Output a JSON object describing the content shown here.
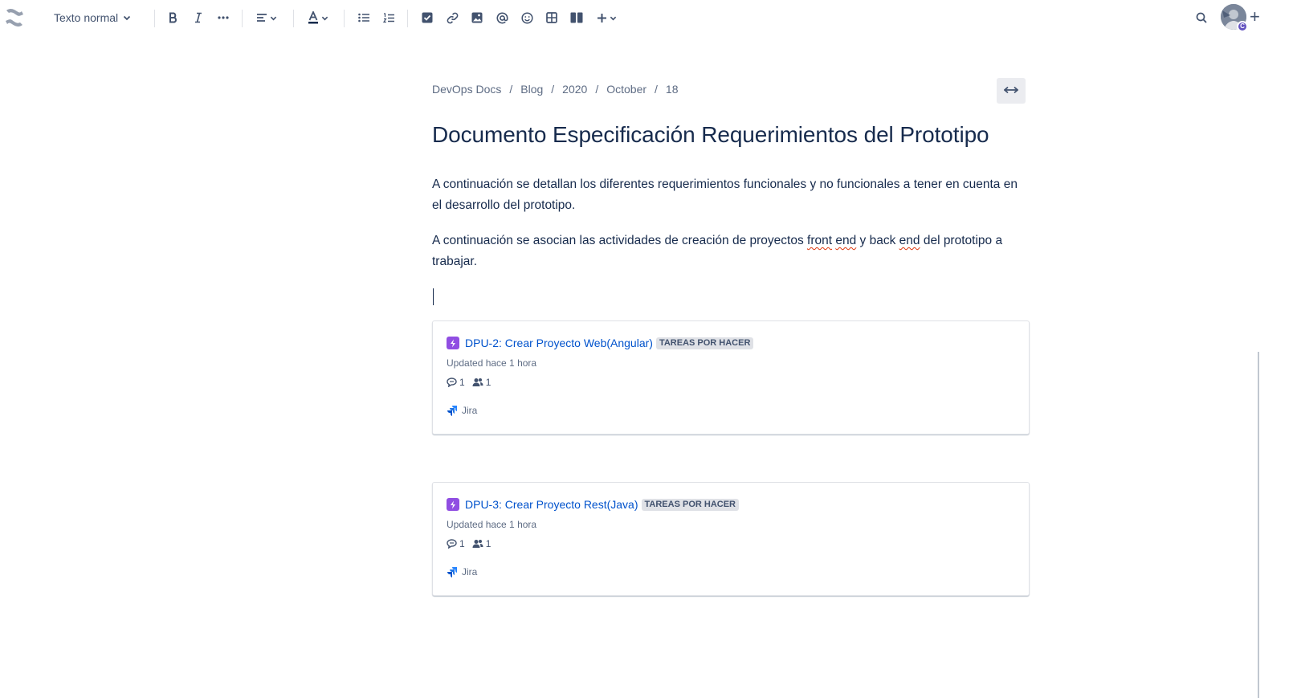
{
  "toolbar": {
    "text_style": "Texto normal",
    "tools": [
      {
        "name": "bold-icon"
      },
      {
        "name": "italic-icon"
      },
      {
        "name": "more-formatting-icon"
      },
      {
        "name": "alignment-icon"
      },
      {
        "name": "text-color-icon"
      },
      {
        "name": "bullet-list-icon"
      },
      {
        "name": "numbered-list-icon"
      },
      {
        "name": "action-item-icon"
      },
      {
        "name": "link-icon"
      },
      {
        "name": "image-icon"
      },
      {
        "name": "mention-icon"
      },
      {
        "name": "emoji-icon"
      },
      {
        "name": "table-icon"
      },
      {
        "name": "layouts-icon"
      },
      {
        "name": "insert-plus-icon"
      },
      {
        "name": "search-icon"
      }
    ],
    "avatar_badge": "C",
    "colors": {
      "icon": "#42526e",
      "accent": "#0052cc",
      "epic": "#904ee2"
    }
  },
  "breadcrumb": [
    "DevOps Docs",
    "Blog",
    "2020",
    "October",
    "18"
  ],
  "page": {
    "title": "Documento Especificación Requerimientos del Prototipo",
    "paragraph1": "A continuación se detallan los diferentes requerimientos funcionales y no funcionales a tener en cuenta en el desarrollo del prototipo.",
    "paragraph2_a": "A continuación se asocian las actividades de creación de proyectos ",
    "paragraph2_front": "front",
    "paragraph2_space": " ",
    "paragraph2_end1": "end",
    "paragraph2_b": " y back ",
    "paragraph2_end2": "end",
    "paragraph2_c": " del prototipo a trabajar."
  },
  "cards": [
    {
      "issue": "DPU-2: Crear Proyecto Web(Angular)",
      "status": "TAREAS POR HACER",
      "updated": "Updated hace 1 hora",
      "comments": "1",
      "watchers": "1",
      "source": "Jira"
    },
    {
      "issue": "DPU-3: Crear Proyecto Rest(Java)",
      "status": "TAREAS POR HACER",
      "updated": "Updated hace 1 hora",
      "comments": "1",
      "watchers": "1",
      "source": "Jira"
    }
  ]
}
